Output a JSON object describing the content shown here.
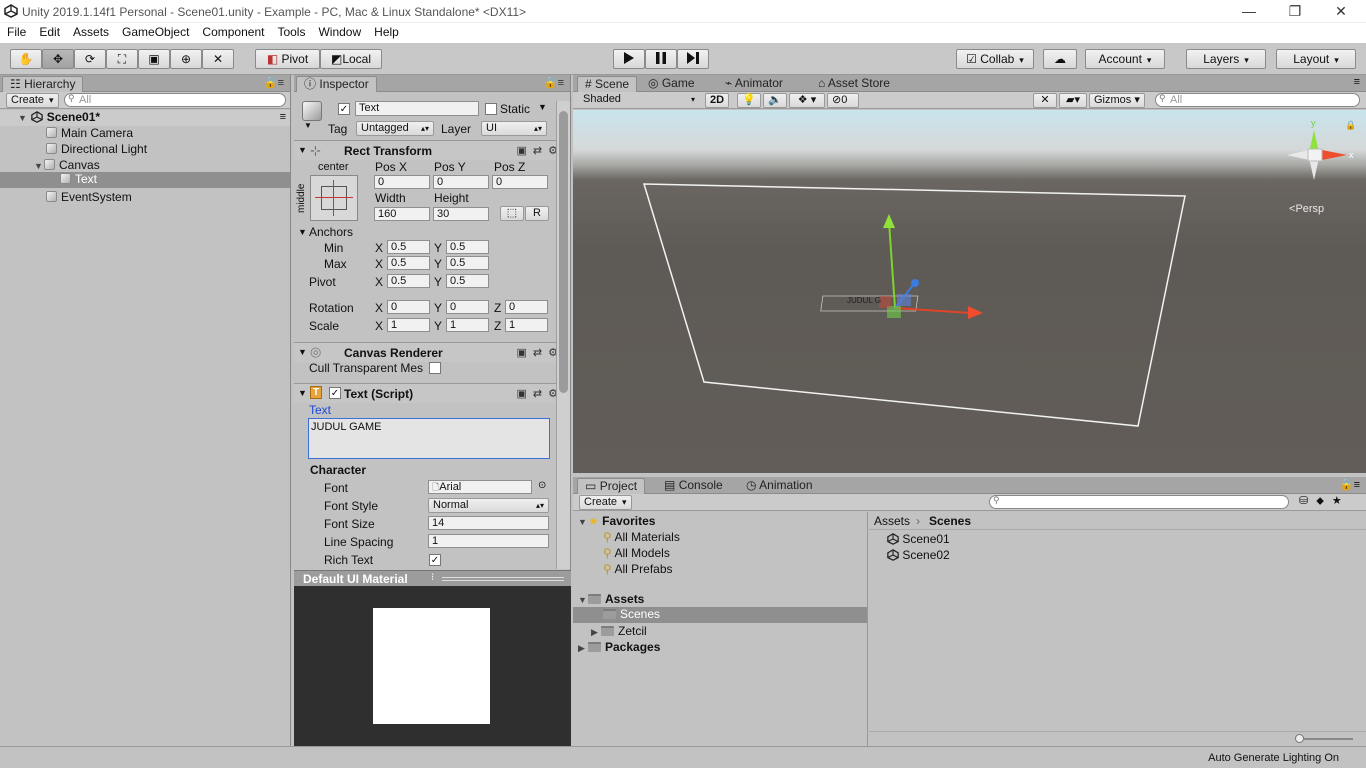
{
  "window": {
    "title": "Unity 2019.1.14f1 Personal - Scene01.unity - Example - PC, Mac & Linux Standalone* <DX11>"
  },
  "menu": [
    "File",
    "Edit",
    "Assets",
    "GameObject",
    "Component",
    "Tools",
    "Window",
    "Help"
  ],
  "toolbar": {
    "pivot": "Pivot",
    "local": "Local",
    "collab": "Collab",
    "account": "Account",
    "layers": "Layers",
    "layout": "Layout"
  },
  "hierarchy": {
    "tab": "Hierarchy",
    "create": "Create",
    "search_placeholder": "All",
    "scene": "Scene01*",
    "items": [
      "Main Camera",
      "Directional Light",
      "Canvas",
      "Text",
      "EventSystem"
    ]
  },
  "inspector": {
    "tab": "Inspector",
    "object_name": "Text",
    "static_label": "Static",
    "tag_label": "Tag",
    "tag_value": "Untagged",
    "layer_label": "Layer",
    "layer_value": "UI",
    "rect": {
      "title": "Rect Transform",
      "anchor_h": "center",
      "anchor_v": "middle",
      "posx_label": "Pos X",
      "posy_label": "Pos Y",
      "posz_label": "Pos Z",
      "posx": "0",
      "posy": "0",
      "posz": "0",
      "width_label": "Width",
      "height_label": "Height",
      "width": "160",
      "height": "30",
      "r_button": "R",
      "anchors_label": "Anchors",
      "min_label": "Min",
      "max_label": "Max",
      "min_x": "0.5",
      "min_y": "0.5",
      "max_x": "0.5",
      "max_y": "0.5",
      "pivot_label": "Pivot",
      "pivot_x": "0.5",
      "pivot_y": "0.5",
      "rotation_label": "Rotation",
      "rot_x": "0",
      "rot_y": "0",
      "rot_z": "0",
      "scale_label": "Scale",
      "scale_x": "1",
      "scale_y": "1",
      "scale_z": "1",
      "x": "X",
      "y": "Y",
      "z": "Z"
    },
    "canvas_renderer": {
      "title": "Canvas Renderer",
      "cull_label": "Cull Transparent Mes"
    },
    "text_script": {
      "title": "Text (Script)",
      "text_label": "Text",
      "text_value": "JUDUL GAME",
      "character_label": "Character",
      "font_label": "Font",
      "font_value": "Arial",
      "style_label": "Font Style",
      "style_value": "Normal",
      "size_label": "Font Size",
      "size_value": "14",
      "spacing_label": "Line Spacing",
      "spacing_value": "1",
      "rich_label": "Rich Text"
    },
    "material": {
      "title": "Default UI Material"
    }
  },
  "scene_view": {
    "tabs": [
      "Scene",
      "Game",
      "Animator",
      "Asset Store"
    ],
    "shading": "Shaded",
    "mode_2d": "2D",
    "fx_count": "0",
    "gizmos": "Gizmos",
    "search_placeholder": "All",
    "persp": "Persp",
    "object_label": "JUDUL G"
  },
  "project": {
    "tabs": [
      "Project",
      "Console",
      "Animation"
    ],
    "create": "Create",
    "favorites_label": "Favorites",
    "favorites": [
      "All Materials",
      "All Models",
      "All Prefabs"
    ],
    "assets_label": "Assets",
    "asset_folders": [
      "Scenes",
      "Zetcil"
    ],
    "packages_label": "Packages",
    "breadcrumb": [
      "Assets",
      "Scenes"
    ],
    "files": [
      "Scene01",
      "Scene02"
    ]
  },
  "status": {
    "text": "Auto Generate Lighting On"
  },
  "colors": {
    "sky_top": "#c9e4ec",
    "ground": "#5e5a55",
    "selection": "#8f8f8f",
    "link_blue": "#1a4bd6"
  }
}
